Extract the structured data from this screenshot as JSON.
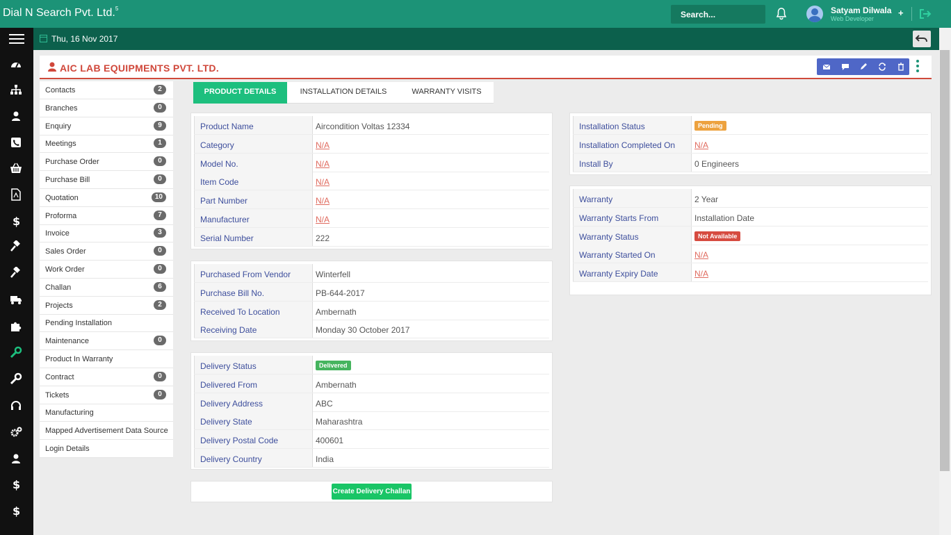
{
  "app": {
    "title": "Dial N Search Pvt. Ltd.",
    "superscript": "5"
  },
  "header": {
    "search_label": "Search...",
    "user_name": "Satyam Dilwala",
    "user_role": "Web Developer",
    "plus": "+"
  },
  "subbar": {
    "date": "Thu, 16 Nov 2017"
  },
  "company": {
    "name": "AIC LAB EQUIPMENTS PVT. LTD."
  },
  "left_menu": [
    {
      "label": "Contacts",
      "count": "2"
    },
    {
      "label": "Branches",
      "count": "0"
    },
    {
      "label": "Enquiry",
      "count": "9"
    },
    {
      "label": "Meetings",
      "count": "1"
    },
    {
      "label": "Purchase Order",
      "count": "0"
    },
    {
      "label": "Purchase Bill",
      "count": "0"
    },
    {
      "label": "Quotation",
      "count": "10"
    },
    {
      "label": "Proforma",
      "count": "7"
    },
    {
      "label": "Invoice",
      "count": "3"
    },
    {
      "label": "Sales Order",
      "count": "0"
    },
    {
      "label": "Work Order",
      "count": "0"
    },
    {
      "label": "Challan",
      "count": "6"
    },
    {
      "label": "Projects",
      "count": "2"
    },
    {
      "label": "Pending Installation",
      "count": ""
    },
    {
      "label": "Maintenance",
      "count": "0"
    },
    {
      "label": "Product In Warranty",
      "count": ""
    },
    {
      "label": "Contract",
      "count": "0"
    },
    {
      "label": "Tickets",
      "count": "0"
    },
    {
      "label": "Manufacturing",
      "count": ""
    },
    {
      "label": "Mapped Advertisement Data Source",
      "count": ""
    },
    {
      "label": "Login Details",
      "count": ""
    }
  ],
  "tabs": [
    {
      "label": "PRODUCT DETAILS"
    },
    {
      "label": "INSTALLATION DETAILS"
    },
    {
      "label": "WARRANTY VISITS"
    }
  ],
  "product": [
    {
      "key": "Product Name",
      "value": "Aircondition Voltas 12334"
    },
    {
      "key": "Category",
      "value": "N/A"
    },
    {
      "key": "Model No.",
      "value": "N/A"
    },
    {
      "key": "Item Code",
      "value": "N/A"
    },
    {
      "key": "Part Number",
      "value": "N/A"
    },
    {
      "key": "Manufacturer",
      "value": "N/A"
    },
    {
      "key": "Serial Number",
      "value": "222"
    }
  ],
  "purchase": [
    {
      "key": "Purchased From Vendor",
      "value": "Winterfell"
    },
    {
      "key": "Purchase Bill No.",
      "value": "PB-644-2017"
    },
    {
      "key": "Received To Location",
      "value": "Ambernath"
    },
    {
      "key": "Receiving Date",
      "value": "Monday 30 October 2017"
    }
  ],
  "delivery": [
    {
      "key": "Delivery Status",
      "value": "Delivered"
    },
    {
      "key": "Delivered From",
      "value": "Ambernath"
    },
    {
      "key": "Delivery Address",
      "value": "ABC"
    },
    {
      "key": "Delivery State",
      "value": "Maharashtra"
    },
    {
      "key": "Delivery Postal Code",
      "value": "400601"
    },
    {
      "key": "Delivery Country",
      "value": "India"
    }
  ],
  "installation": [
    {
      "key": "Installation Status",
      "value": "Pending"
    },
    {
      "key": "Installation Completed On",
      "value": "N/A"
    },
    {
      "key": "Install By",
      "value": "0 Engineers"
    }
  ],
  "warranty": [
    {
      "key": "Warranty",
      "value": "2 Year"
    },
    {
      "key": "Warranty Starts From",
      "value": "Installation Date"
    },
    {
      "key": "Warranty Status",
      "value": "Not Available"
    },
    {
      "key": "Warranty Started On",
      "value": "N/A"
    },
    {
      "key": "Warranty Expiry Date",
      "value": "N/A"
    }
  ],
  "actions": {
    "create_challan": "Create Delivery Challan"
  },
  "colors": {
    "brand": "#1c9377",
    "subbar": "#0c604c",
    "accent_red": "#d0473a",
    "label_blue": "#3d4e9c",
    "tab_active": "#1dbf7e",
    "action_bar": "#4f67c7"
  },
  "icons": {
    "sidebar": [
      "dashboard-icon",
      "sitemap-icon",
      "user-icon",
      "phone-icon",
      "basket-icon",
      "pdf-icon",
      "dollar-icon",
      "gavel-icon",
      "gavel-icon",
      "truck-icon",
      "puzzle-icon",
      "wrench-icon",
      "wrench-icon",
      "headset-icon",
      "cogs-icon",
      "user-icon",
      "dollar-icon",
      "dollar-icon"
    ],
    "actions": [
      "mail-icon",
      "comment-icon",
      "edit-icon",
      "refresh-icon",
      "trash-icon"
    ]
  }
}
